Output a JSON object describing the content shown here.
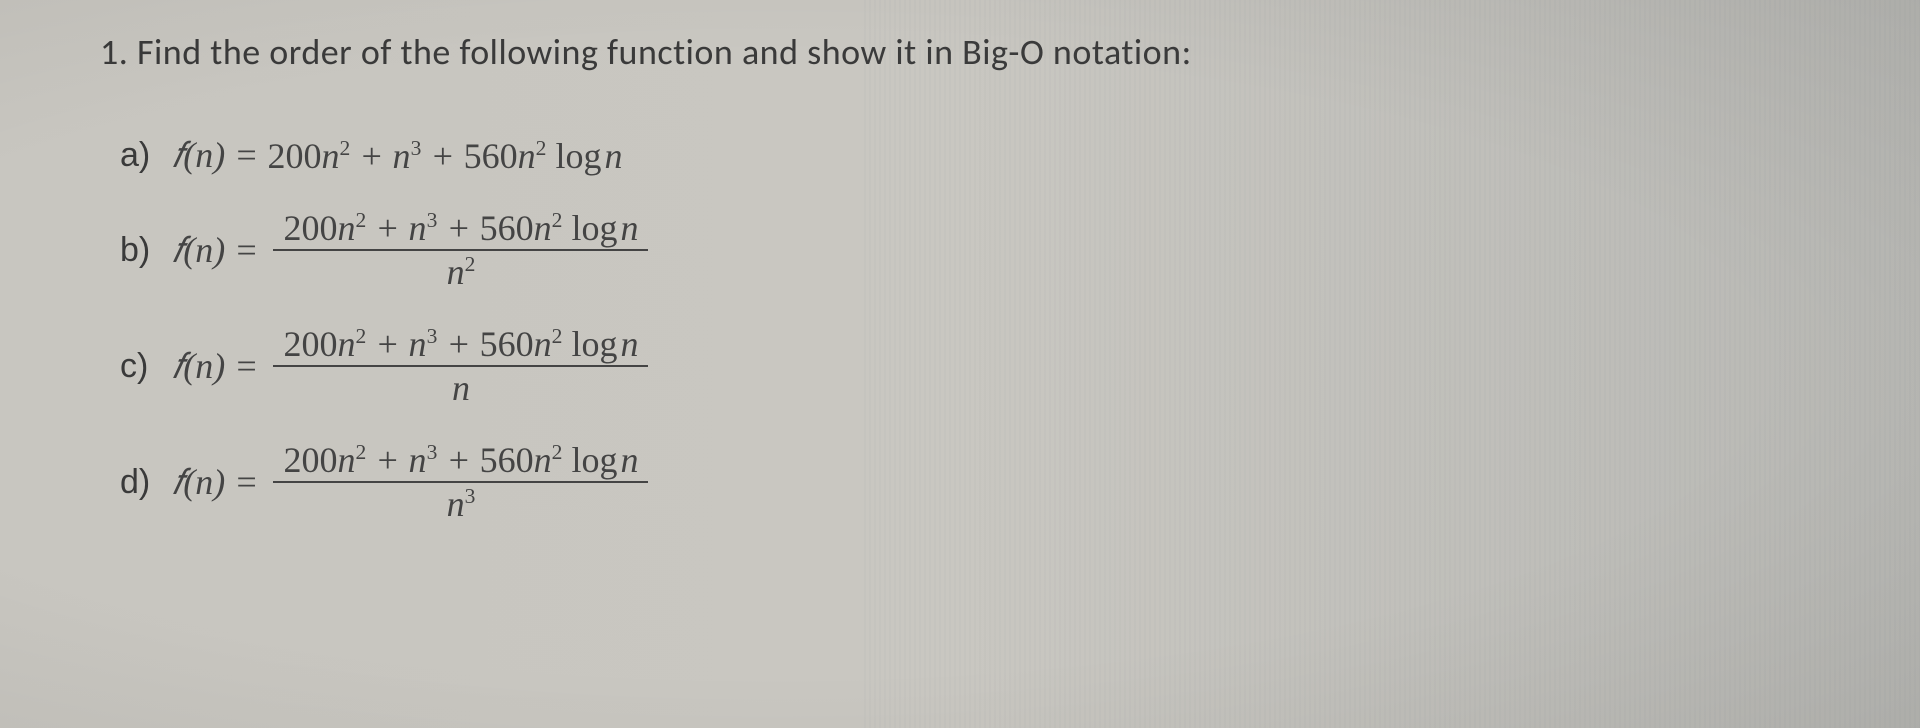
{
  "question": {
    "number": "1.",
    "text": "Find the order of the following function and show it in Big-O notation:"
  },
  "parts": {
    "a": {
      "label": "a)",
      "lhs": "f(n) =",
      "rhs_plain": "200n² + n³ + 560n² log n"
    },
    "b": {
      "label": "b)",
      "lhs": "f(n) =",
      "numerator": "200n² + n³ + 560n² log n",
      "denominator": "n²"
    },
    "c": {
      "label": "c)",
      "lhs": "f(n) =",
      "numerator": "200n² + n³ + 560n² log n",
      "denominator": "n"
    },
    "d": {
      "label": "d)",
      "lhs": "f(n) =",
      "numerator": "200n² + n³ + 560n² log n",
      "denominator": "n³"
    }
  }
}
